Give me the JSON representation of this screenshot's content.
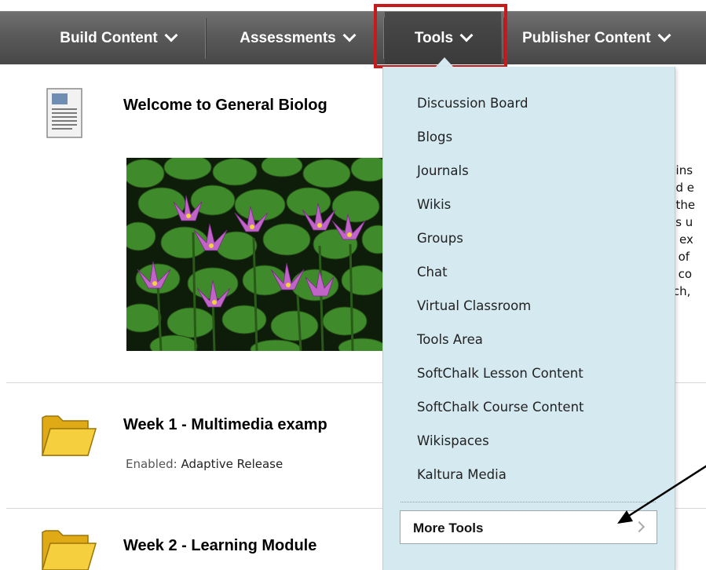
{
  "toolbar": {
    "build_content": "Build Content",
    "assessments": "Assessments",
    "tools": "Tools",
    "publisher_content": "Publisher Content"
  },
  "content": {
    "welcome_title": "Welcome to General Biolog",
    "side_text_lines": [
      "gins",
      "nd e",
      ", the",
      "as u",
      "e ex",
      "s of",
      "s co",
      "rch,"
    ],
    "week1_title": "Week 1 - Multimedia examp",
    "week1_enabled_label": "Enabled:",
    "week1_enabled_value": "Adaptive Release",
    "week2_title": "Week 2 - Learning Module"
  },
  "tools_menu": {
    "items": [
      "Discussion Board",
      "Blogs",
      "Journals",
      "Wikis",
      "Groups",
      "Chat",
      "Virtual Classroom",
      "Tools Area",
      "SoftChalk Lesson Content",
      "SoftChalk Course Content",
      "Wikispaces",
      "Kaltura Media"
    ],
    "more_tools": "More Tools"
  },
  "colors": {
    "toolbar": "#5a5a5a",
    "highlight_box": "#c81a1a",
    "menu_background": "#d5e9f1",
    "folder": "#f2c12e"
  },
  "icons": {
    "document": "document-icon",
    "folder": "folder-icon",
    "chevron": "chevron-down-icon",
    "more_arrow": "chevron-right-icon"
  }
}
